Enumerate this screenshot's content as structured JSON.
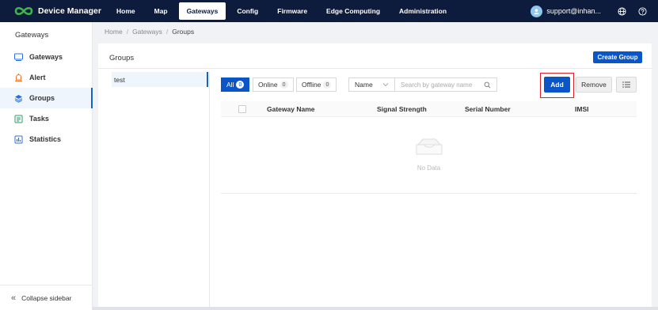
{
  "app": {
    "title": "Device Manager"
  },
  "nav": {
    "items": [
      {
        "label": "Home",
        "active": false
      },
      {
        "label": "Map",
        "active": false
      },
      {
        "label": "Gateways",
        "active": true
      },
      {
        "label": "Config",
        "active": false
      },
      {
        "label": "Firmware",
        "active": false
      },
      {
        "label": "Edge Computing",
        "active": false
      },
      {
        "label": "Administration",
        "active": false
      }
    ]
  },
  "user": {
    "name": "support@inhan..."
  },
  "sidebar": {
    "title": "Gateways",
    "items": [
      {
        "label": "Gateways",
        "icon": "gateway-icon"
      },
      {
        "label": "Alert",
        "icon": "alert-icon"
      },
      {
        "label": "Groups",
        "icon": "layers-icon",
        "active": true
      },
      {
        "label": "Tasks",
        "icon": "tasks-icon"
      },
      {
        "label": "Statistics",
        "icon": "statistics-icon"
      }
    ],
    "collapse_label": "Collapse sidebar"
  },
  "breadcrumb": {
    "items": [
      "Home",
      "Gateways",
      "Groups"
    ]
  },
  "panel": {
    "title": "Groups",
    "create_label": "Create Group",
    "groups": [
      "test"
    ]
  },
  "filters": {
    "tabs": [
      {
        "label": "All",
        "count": "0",
        "active": true
      },
      {
        "label": "Online",
        "count": "0",
        "active": false
      },
      {
        "label": "Offline",
        "count": "0",
        "active": false
      }
    ],
    "select_value": "Name",
    "search_placeholder": "Search by gateway name"
  },
  "actions": {
    "add_label": "Add",
    "remove_label": "Remove"
  },
  "table": {
    "columns": [
      "Gateway Name",
      "Signal Strength",
      "Serial Number",
      "IMSI"
    ],
    "empty_text": "No Data"
  },
  "colors": {
    "topbar": "#0d1c3d",
    "accent": "#0a56c8",
    "highlight": "#d9232d"
  }
}
